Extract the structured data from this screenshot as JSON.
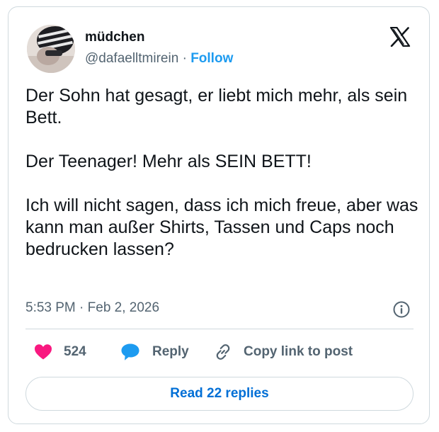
{
  "author": {
    "display_name": "müdchen",
    "handle": "@dafaelltmirein",
    "separator": "·",
    "follow_label": "Follow"
  },
  "tweet": {
    "paragraphs": [
      "Der Sohn hat gesagt, er liebt mich  mehr, als sein Bett.",
      "Der Teenager! Mehr als SEIN BETT!",
      "Ich will nicht sagen, dass ich mich freue, aber was kann man außer Shirts, Tassen und Caps noch bedrucken lassen?"
    ],
    "timestamp": "5:53 PM · Feb 2, 2026"
  },
  "actions": {
    "like_count": "524",
    "reply_label": "Reply",
    "copy_label": "Copy link to post"
  },
  "read_replies_label": "Read 22 replies",
  "colors": {
    "like": "#f91880",
    "reply": "#1d9bf0",
    "link": "#1d9bf0",
    "border": "#cfd9de",
    "muted_text": "#536471"
  },
  "icons": {
    "brand": "x-logo-icon",
    "info": "info-icon",
    "like": "heart-icon",
    "reply": "speech-bubble-icon",
    "copy": "link-icon"
  }
}
